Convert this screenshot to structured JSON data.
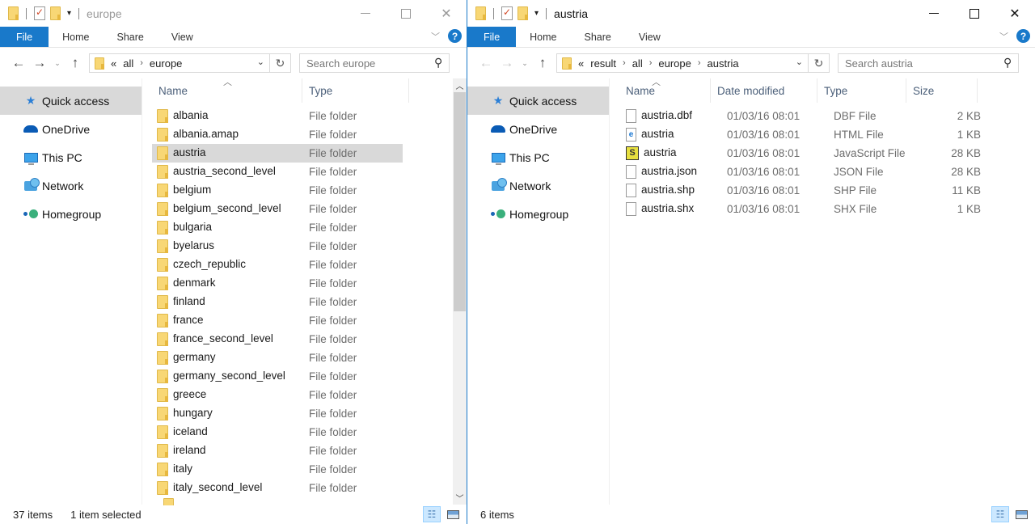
{
  "left_window": {
    "title": "europe",
    "ribbon_tabs": [
      "File",
      "Home",
      "Share",
      "View"
    ],
    "breadcrumb": [
      "«",
      "all",
      "europe"
    ],
    "search_placeholder": "Search europe",
    "nav_pane": [
      "Quick access",
      "OneDrive",
      "This PC",
      "Network",
      "Homegroup"
    ],
    "columns": {
      "name": "Name",
      "type": "Type"
    },
    "rows": [
      {
        "name": "albania",
        "type": "File folder"
      },
      {
        "name": "albania.amap",
        "type": "File folder"
      },
      {
        "name": "austria",
        "type": "File folder",
        "selected": true
      },
      {
        "name": "austria_second_level",
        "type": "File folder"
      },
      {
        "name": "belgium",
        "type": "File folder"
      },
      {
        "name": "belgium_second_level",
        "type": "File folder"
      },
      {
        "name": "bulgaria",
        "type": "File folder"
      },
      {
        "name": "byelarus",
        "type": "File folder"
      },
      {
        "name": "czech_republic",
        "type": "File folder"
      },
      {
        "name": "denmark",
        "type": "File folder"
      },
      {
        "name": "finland",
        "type": "File folder"
      },
      {
        "name": "france",
        "type": "File folder"
      },
      {
        "name": "france_second_level",
        "type": "File folder"
      },
      {
        "name": "germany",
        "type": "File folder"
      },
      {
        "name": "germany_second_level",
        "type": "File folder"
      },
      {
        "name": "greece",
        "type": "File folder"
      },
      {
        "name": "hungary",
        "type": "File folder"
      },
      {
        "name": "iceland",
        "type": "File folder"
      },
      {
        "name": "ireland",
        "type": "File folder"
      },
      {
        "name": "italy",
        "type": "File folder"
      },
      {
        "name": "italy_second_level",
        "type": "File folder"
      }
    ],
    "status": {
      "count": "37 items",
      "selected": "1 item selected"
    },
    "scroll_position": 0.0,
    "scroll_visible_fraction": 0.55
  },
  "right_window": {
    "title": "austria",
    "ribbon_tabs": [
      "File",
      "Home",
      "Share",
      "View"
    ],
    "breadcrumb": [
      "«",
      "result",
      "all",
      "europe",
      "austria"
    ],
    "search_placeholder": "Search austria",
    "nav_pane": [
      "Quick access",
      "OneDrive",
      "This PC",
      "Network",
      "Homegroup"
    ],
    "columns": {
      "name": "Name",
      "date": "Date modified",
      "type": "Type",
      "size": "Size"
    },
    "rows": [
      {
        "name": "austria.dbf",
        "date": "01/03/16 08:01",
        "type": "DBF File",
        "size": "2 KB",
        "icon": "file-icon"
      },
      {
        "name": "austria",
        "date": "01/03/16 08:01",
        "type": "HTML File",
        "size": "1 KB",
        "icon": "html-file-icon"
      },
      {
        "name": "austria",
        "date": "01/03/16 08:01",
        "type": "JavaScript File",
        "size": "28 KB",
        "icon": "javascript-file-icon"
      },
      {
        "name": "austria.json",
        "date": "01/03/16 08:01",
        "type": "JSON File",
        "size": "28 KB",
        "icon": "file-icon"
      },
      {
        "name": "austria.shp",
        "date": "01/03/16 08:01",
        "type": "SHP File",
        "size": "11 KB",
        "icon": "file-icon"
      },
      {
        "name": "austria.shx",
        "date": "01/03/16 08:01",
        "type": "SHX File",
        "size": "1 KB",
        "icon": "file-icon"
      }
    ],
    "status": {
      "count": "6 items"
    }
  },
  "colors": {
    "accent": "#1979ca",
    "selection": "#d9d9d9",
    "folder": "#f8d775"
  }
}
